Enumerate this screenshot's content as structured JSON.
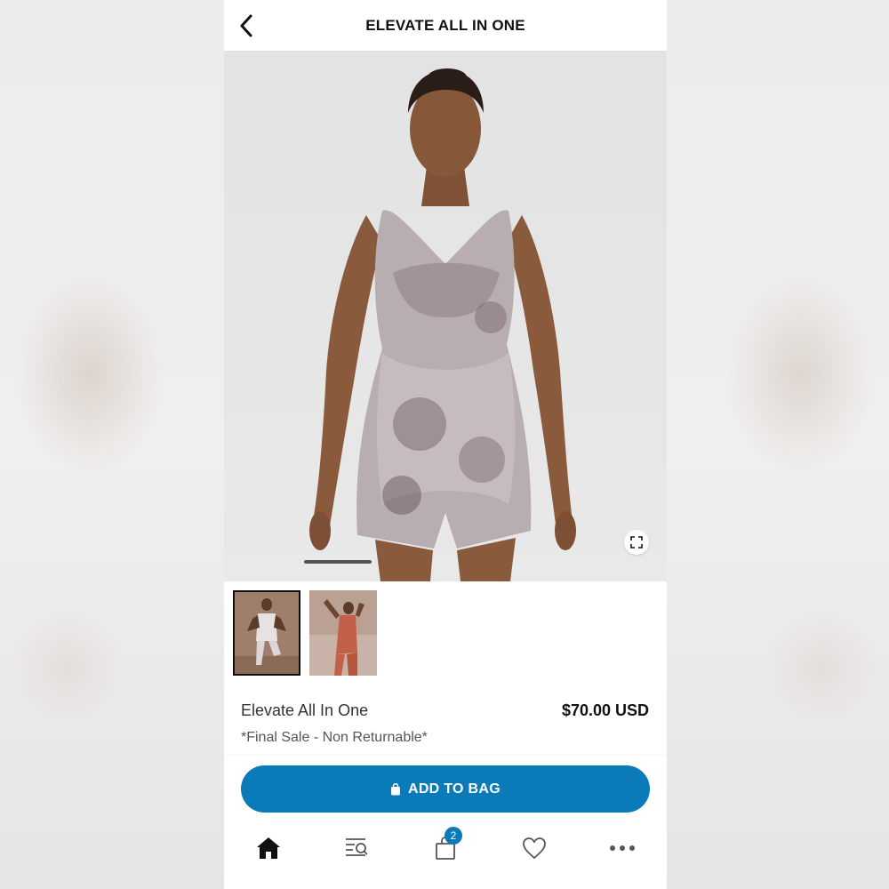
{
  "header": {
    "title": "ELEVATE ALL IN ONE",
    "back_icon": "chevron-left-icon"
  },
  "gallery": {
    "expand_icon": "expand-icon",
    "thumbnails": [
      {
        "name": "thumbnail-print",
        "selected": true
      },
      {
        "name": "thumbnail-coral",
        "selected": false
      }
    ]
  },
  "product": {
    "name": "Elevate All In One",
    "price": "$70.00 USD",
    "note": "*Final Sale - Non Returnable*"
  },
  "actions": {
    "add_to_bag": "ADD TO BAG",
    "bag_icon": "shopping-bag-icon",
    "color": "#0a7ab8"
  },
  "bottom_nav": {
    "items": [
      "home-icon",
      "search-list-icon",
      "bag-icon",
      "heart-icon",
      "more-icon"
    ],
    "bag_badge": "2"
  }
}
